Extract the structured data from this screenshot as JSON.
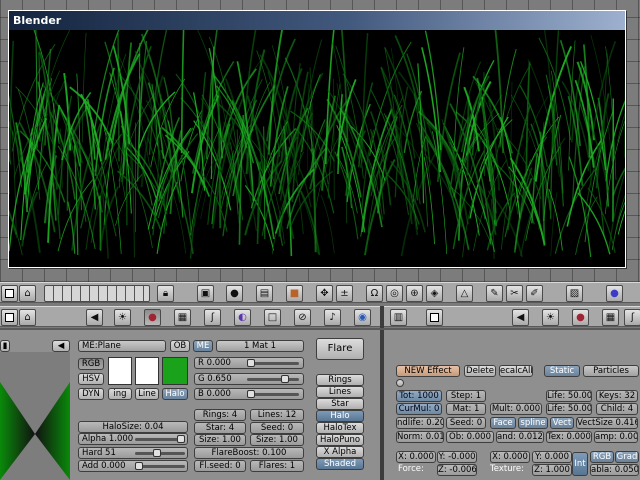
{
  "render_window": {
    "title": "Blender"
  },
  "colors": {
    "grass_primary": "#1fae24",
    "grass_dark": "#0b5c0f",
    "halo_color": "#1aa31a",
    "render_bg": "#000000"
  },
  "header_left": {
    "icons": [
      "checkbox-icon",
      "home-icon",
      "layer-grid-icon",
      "lock-icon",
      "view-icon",
      "shading-icon",
      "pivot-icon",
      "mesh-icon",
      "move-icon",
      "scale-icon",
      "snap-icon",
      "proportional-icon",
      "grab-icon",
      "rotate-icon",
      "tool-icon",
      "image-icon",
      "blender-icon"
    ]
  },
  "material_panel": {
    "me_field": "ME:Plane",
    "ob_button": "OB",
    "me_button": "ME",
    "mat_field": "1 Mat 1",
    "flare_button": "Flare",
    "color_modes": [
      "RGB",
      "HSV",
      "DYN"
    ],
    "swatch_labels": [
      "ing",
      "Line",
      "Halo"
    ],
    "r_slider": {
      "label": "R 0.000",
      "value": 0.0
    },
    "g_slider": {
      "label": "G 0.650",
      "value": 0.65
    },
    "b_slider": {
      "label": "B 0.000",
      "value": 0.0
    },
    "rings": "Rings: 4",
    "lines": "Lines: 12",
    "star": "Star: 4",
    "seed": "Seed: 0",
    "size_1": "Size: 1.00",
    "size_2": "Size: 1.00",
    "flareboost": "FlareBoost: 0.100",
    "fl_seed": "Fl.seed: 0",
    "flares": "Flares: 1",
    "halo_size": "HaloSize: 0.04",
    "alpha": {
      "label": "Alpha 1.000",
      "value": 1.0
    },
    "hard": {
      "label": "Hard 51",
      "value": 0.4
    },
    "add": {
      "label": "Add  0.000",
      "value": 0.0
    },
    "halo_toggles": [
      "Rings",
      "Lines",
      "Star",
      "Halo",
      "HaloTex",
      "HaloPuno",
      "X Alpha",
      "Shaded"
    ]
  },
  "effects_panel": {
    "new_effect": "NEW Effect",
    "delete": "Delete",
    "recalc": "ecalcAll",
    "static": "Static",
    "particles": "Particles",
    "rows": [
      [
        "Tot: 1000",
        "Step: 1",
        "",
        "Life: 50.00",
        "Keys: 32"
      ],
      [
        "CurMul: 0",
        "Mat: 1",
        "Mult: 0.000",
        "Life: 50.00",
        "Child: 4"
      ],
      [
        "ndlife: 0.200",
        "Seed: 0",
        "Face",
        "spline",
        "Vect",
        "VectSize 0.416"
      ],
      [
        "Norm: 0.010",
        "Ob: 0.000",
        "and: 0.012",
        "Tex: 0.000",
        "amp: 0.000"
      ]
    ],
    "force_x": "X: 0.000",
    "force_y": "Y: -0.000",
    "force_z": "Z: -0.006",
    "force_label": "Force:",
    "tex_x": "X: 0.000",
    "tex_y": "Y: 0.000",
    "tex_z": "Z: 1.000",
    "texture_label": "Texture:",
    "int_button": "Int",
    "rgb_button": "RGB",
    "grad_button": "Grad",
    "nabla": "abla: 0.050"
  }
}
